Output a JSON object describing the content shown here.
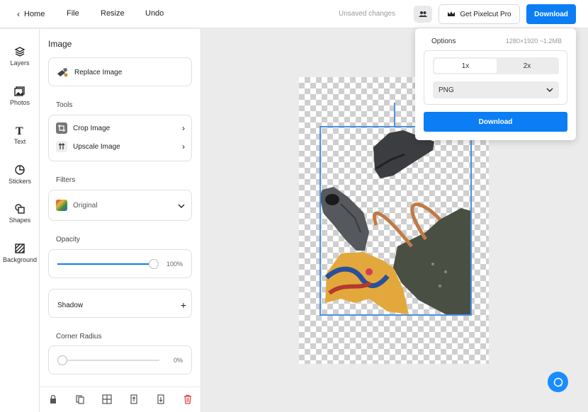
{
  "topbar": {
    "home_label": "Home",
    "file_label": "File",
    "resize_label": "Resize",
    "undo_label": "Undo",
    "status_text": "Unsaved changes",
    "pro_label": "Get Pixelcut Pro",
    "download_label": "Download"
  },
  "rail": {
    "items": [
      {
        "label": "Layers",
        "icon": "layers-icon"
      },
      {
        "label": "Photos",
        "icon": "photos-icon"
      },
      {
        "label": "Text",
        "icon": "text-icon"
      },
      {
        "label": "Stickers",
        "icon": "stickers-icon"
      },
      {
        "label": "Shapes",
        "icon": "shapes-icon"
      },
      {
        "label": "Background",
        "icon": "background-icon"
      }
    ]
  },
  "panel": {
    "title": "Image",
    "replace_label": "Replace Image",
    "tools_label": "Tools",
    "crop_label": "Crop Image",
    "upscale_label": "Upscale Image",
    "filters_label": "Filters",
    "filter_value": "Original",
    "opacity_label": "Opacity",
    "opacity_value": "100%",
    "opacity_fraction": 1.0,
    "shadow_label": "Shadow",
    "corner_label": "Corner Radius",
    "corner_value": "0%",
    "corner_fraction": 0.0
  },
  "popup": {
    "options_label": "Options",
    "size_text": "1280×1920 ~1.2MB",
    "scale_options": [
      "1x",
      "2x"
    ],
    "selected_scale": "1x",
    "format_value": "PNG",
    "download_label": "Download"
  },
  "colors": {
    "accent": "#0b7df5",
    "selection": "#4a90e2"
  }
}
